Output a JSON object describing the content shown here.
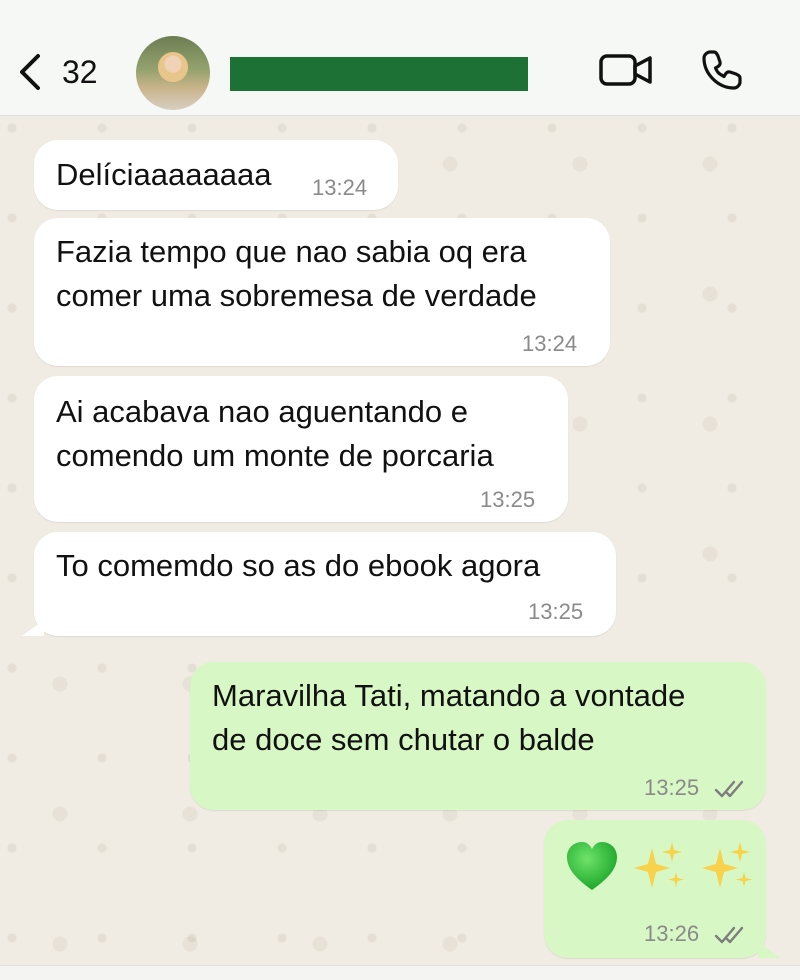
{
  "header": {
    "unread_count": "32",
    "contact_name": "",
    "icons": [
      "back-icon",
      "video-call-icon",
      "phone-call-icon"
    ],
    "name_bar_color": "#1e7134"
  },
  "messages": [
    {
      "direction": "incoming",
      "text": "Delíciaaaaaaaa",
      "time": "13:24"
    },
    {
      "direction": "incoming",
      "text": "Fazia tempo que nao sabia oq era\ncomer uma sobremesa de verdade",
      "time": "13:24"
    },
    {
      "direction": "incoming",
      "text": "Ai acabava nao aguentando e\ncomendo um monte de porcaria",
      "time": "13:25"
    },
    {
      "direction": "incoming",
      "text": "To comemdo so as do ebook agora",
      "time": "13:25"
    },
    {
      "direction": "outgoing",
      "text": "Maravilha Tati, matando a vontade\nde doce sem chutar o balde",
      "time": "13:25",
      "status": "read"
    },
    {
      "direction": "outgoing",
      "emojis": [
        "green-heart",
        "sparkles",
        "sparkles"
      ],
      "time": "13:26",
      "status": "read"
    }
  ],
  "colors": {
    "incoming_bubble": "#ffffff",
    "outgoing_bubble": "#d7f7c5",
    "chat_background": "#f1ece3",
    "timestamp": "#8a8a8a"
  }
}
